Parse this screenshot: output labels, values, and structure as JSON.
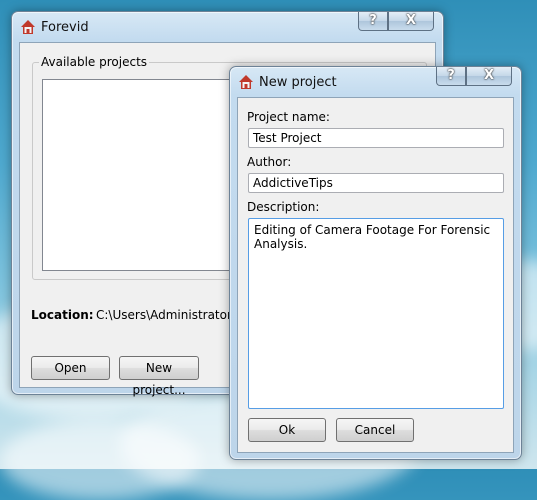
{
  "main_window": {
    "title": "Forevid",
    "help_glyph": "?",
    "close_glyph": "X",
    "projects_group_label": "Available projects",
    "location_label": "Location:",
    "location_value": "C:\\Users\\Administrator\\Documents",
    "open_button": "Open",
    "new_project_button": "New project..."
  },
  "dialog": {
    "title": "New project",
    "help_glyph": "?",
    "close_glyph": "X",
    "project_name_label": "Project name:",
    "project_name_value": "Test Project",
    "author_label": "Author:",
    "author_value": "AddictiveTips",
    "description_label": "Description:",
    "description_value": "Editing of Camera Footage For Forensic Analysis.",
    "ok_button": "Ok",
    "cancel_button": "Cancel"
  },
  "icons": {
    "app_icon": "home-icon",
    "help": "help-icon",
    "close": "close-icon"
  },
  "colors": {
    "window_frame": "#c3dbef",
    "client_bg": "#f0f0f0",
    "focus_border": "#569de5",
    "app_icon_roof": "#c0392b"
  }
}
